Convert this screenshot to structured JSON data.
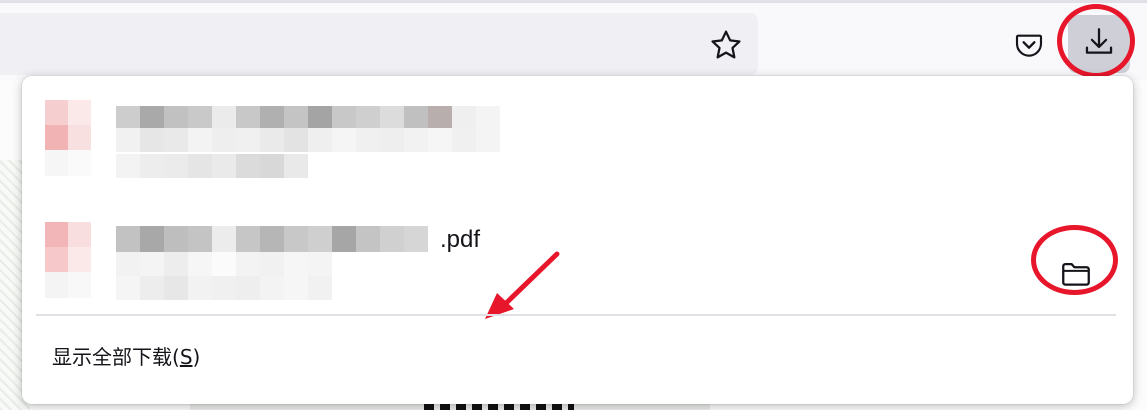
{
  "toolbar": {
    "bookmark_icon": "star-outline-icon",
    "pocket_icon": "pocket-icon",
    "downloads_icon": "download-arrow-icon",
    "annotation_color": "#e8162b"
  },
  "downloads_panel": {
    "items": [
      {
        "filename_visible": "",
        "meta_visible": "",
        "blurred": true
      },
      {
        "filename_suffix": ".pdf",
        "blurred": true,
        "action_icon": "folder-icon"
      }
    ],
    "show_all": {
      "label": "显示全部下载(",
      "accesskey": "S",
      "label_end": ")"
    }
  }
}
